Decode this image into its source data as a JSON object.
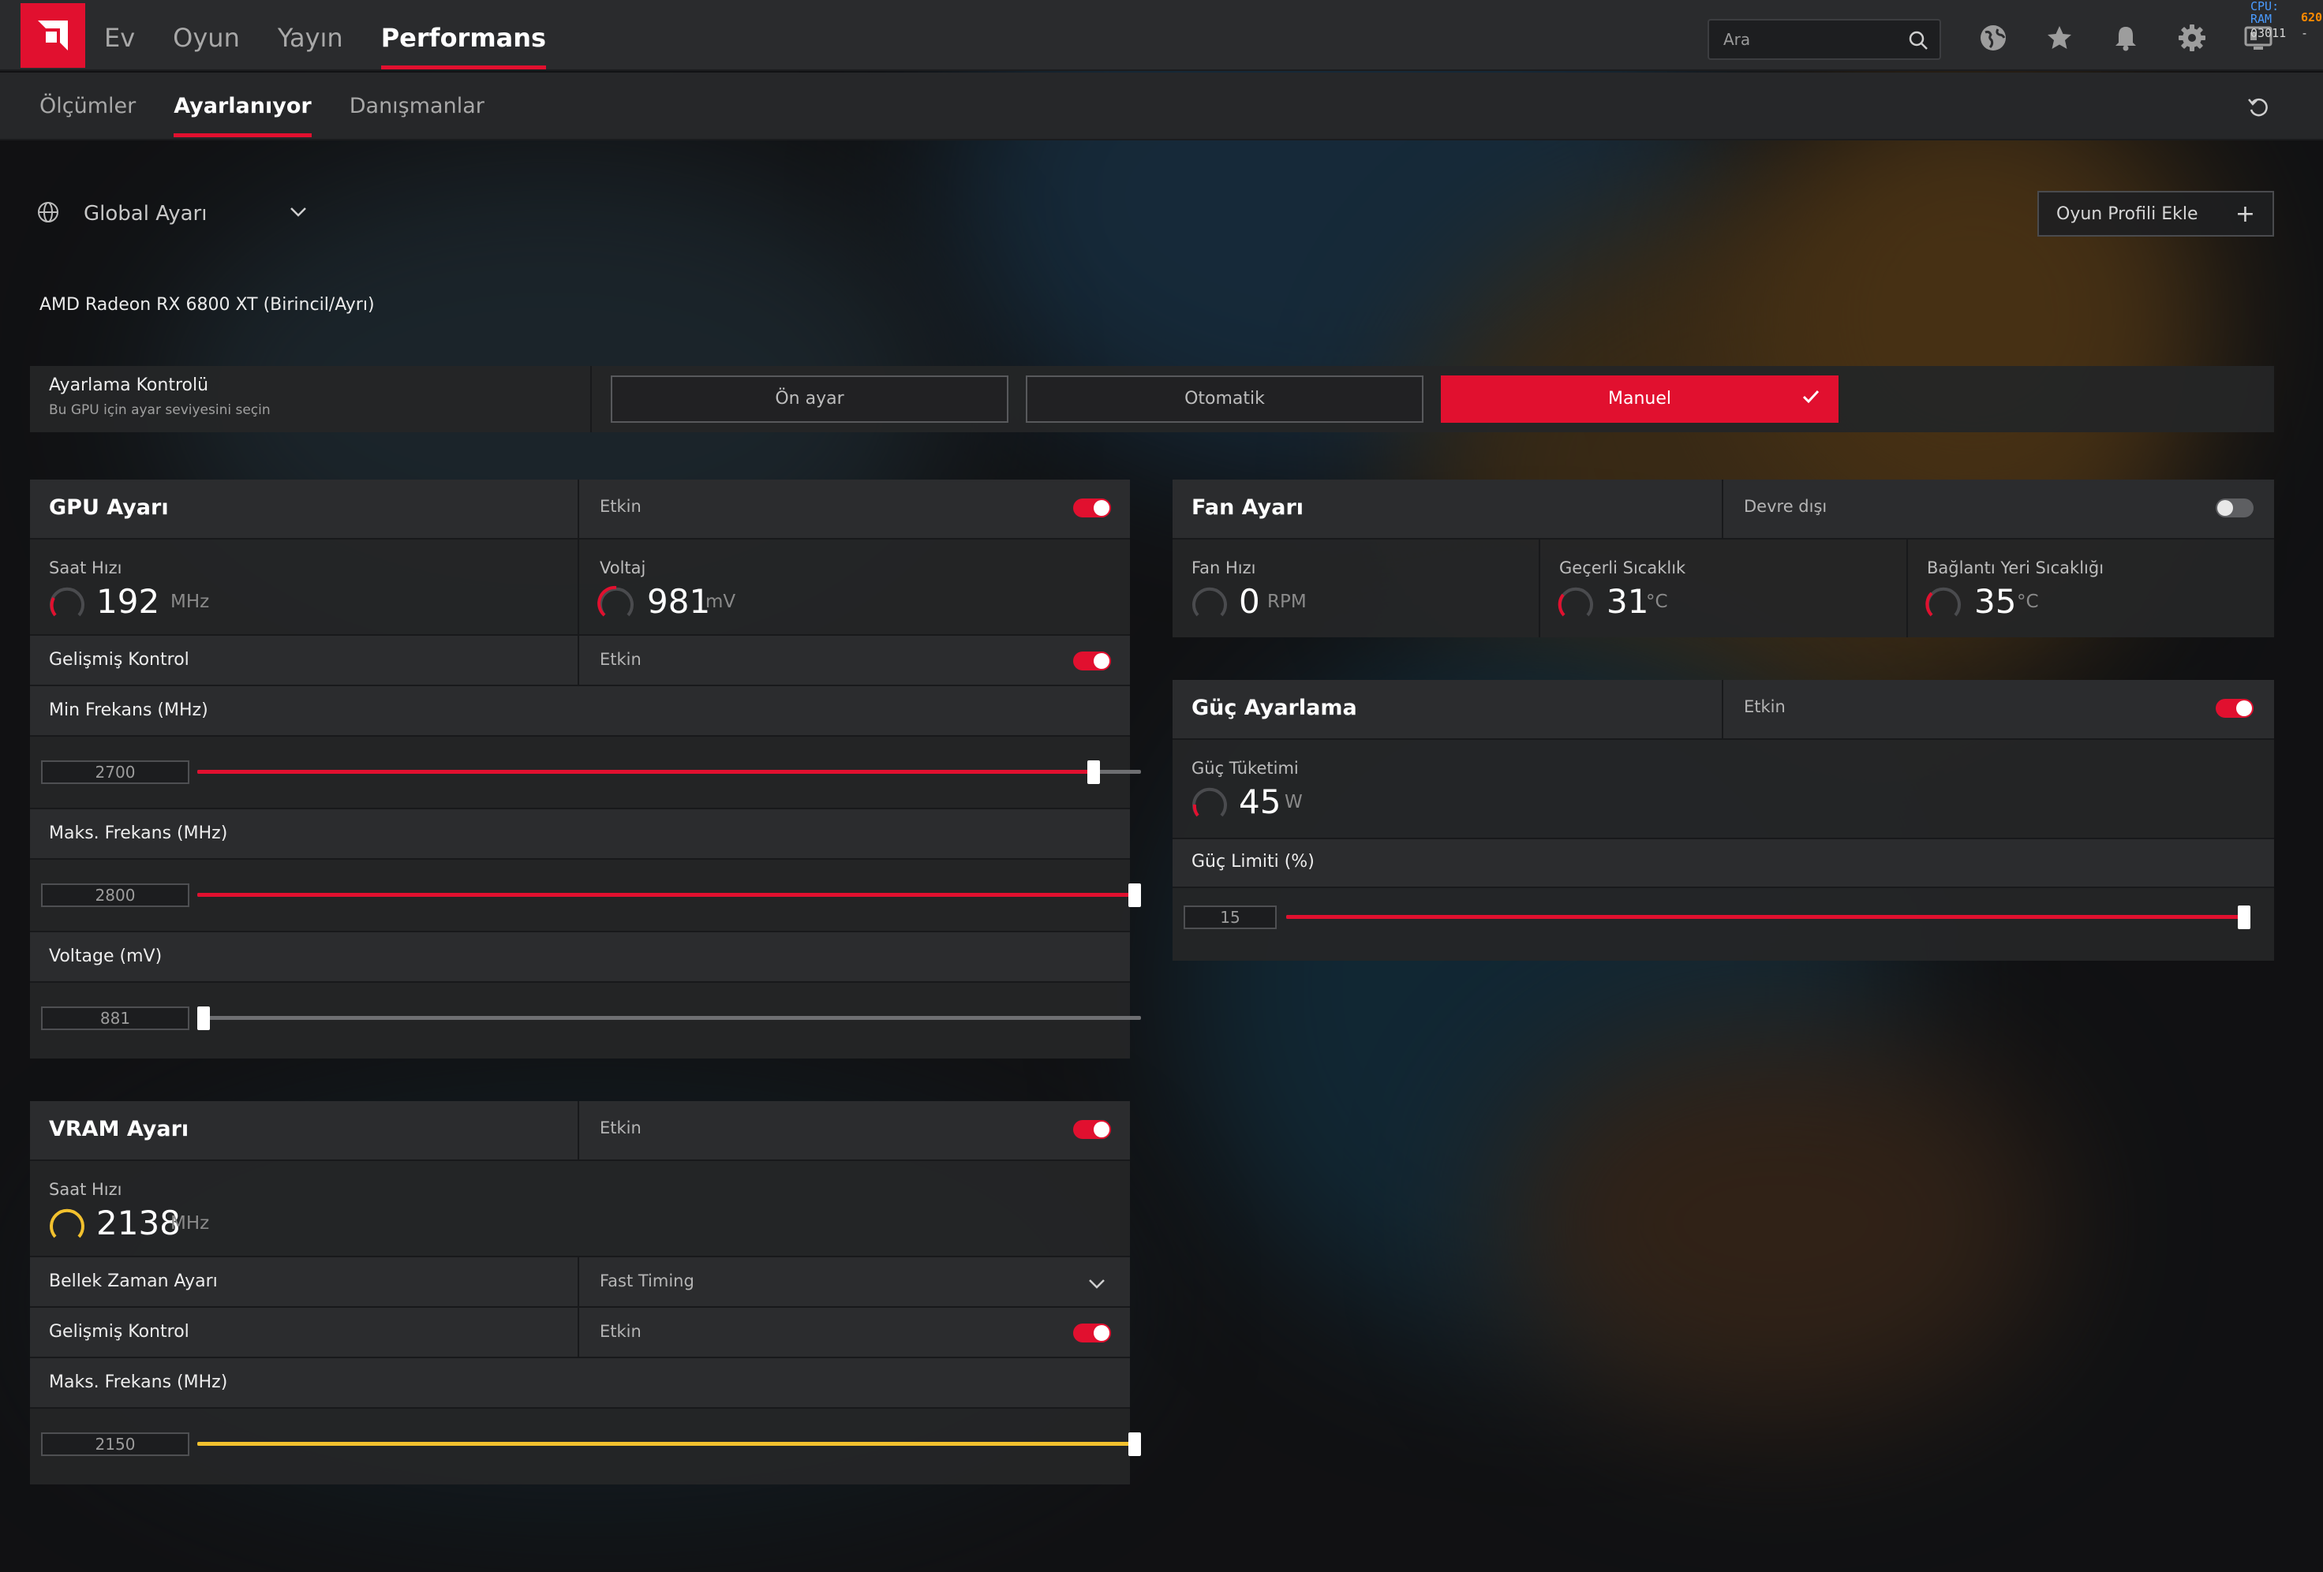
{
  "topnav": {
    "items": [
      "Ev",
      "Oyun",
      "Yayın",
      "Performans"
    ],
    "active_index": 3,
    "search_placeholder": "Ara",
    "icons": [
      "globe-icon",
      "star-icon",
      "bell-icon",
      "gear-icon",
      "monitor-icon"
    ],
    "overlay_stats": {
      "cpu_label": "CPU:",
      "ram_label": "RAM",
      "value_top": "620",
      "value_mid": "03011"
    }
  },
  "subnav": {
    "items": [
      "Ölçümler",
      "Ayarlanıyor",
      "Danışmanlar"
    ],
    "active_index": 1
  },
  "profile": {
    "selected": "Global Ayarı",
    "add_button": "Oyun Profili Ekle"
  },
  "gpu_name": "AMD Radeon RX 6800 XT (Birincil/Ayrı)",
  "tuning_control": {
    "title": "Ayarlama Kontrolü",
    "subtitle": "Bu GPU için ayar seviyesini seçin",
    "options": [
      "Ön ayar",
      "Otomatik",
      "Manuel"
    ],
    "selected": "Manuel"
  },
  "gpu_tuning": {
    "title": "GPU Ayarı",
    "status": "Etkin",
    "enabled": true,
    "clock": {
      "label": "Saat Hızı",
      "value": "192",
      "unit": "MHz"
    },
    "voltage": {
      "label": "Voltaj",
      "value": "981",
      "unit": "mV"
    },
    "advanced": {
      "label": "Gelişmiş Kontrol",
      "status": "Etkin",
      "enabled": true
    },
    "min_freq": {
      "label": "Min Frekans (MHz)",
      "value": "2700",
      "fraction": 0.95
    },
    "max_freq": {
      "label": "Maks. Frekans (MHz)",
      "value": "2800",
      "fraction": 1.0
    },
    "voltage_slider": {
      "label": "Voltage (mV)",
      "value": "881",
      "fraction": 0.0
    }
  },
  "vram_tuning": {
    "title": "VRAM Ayarı",
    "status": "Etkin",
    "enabled": true,
    "clock": {
      "label": "Saat Hızı",
      "value": "2138",
      "unit": "MHz"
    },
    "memory_timing": {
      "label": "Bellek Zaman Ayarı",
      "value": "Fast Timing"
    },
    "advanced": {
      "label": "Gelişmiş Kontrol",
      "status": "Etkin",
      "enabled": true
    },
    "max_freq": {
      "label": "Maks. Frekans (MHz)",
      "value": "2150",
      "fraction": 1.0
    }
  },
  "fan_tuning": {
    "title": "Fan Ayarı",
    "status": "Devre dışı",
    "enabled": false,
    "fan_speed": {
      "label": "Fan Hızı",
      "value": "0",
      "unit": "RPM"
    },
    "current_temp": {
      "label": "Geçerli Sıcaklık",
      "value": "31",
      "unit": "°C"
    },
    "junction_temp": {
      "label": "Bağlantı Yeri Sıcaklığı",
      "value": "35",
      "unit": "°C"
    }
  },
  "power_tuning": {
    "title": "Güç Ayarlama",
    "status": "Etkin",
    "enabled": true,
    "consumption": {
      "label": "Güç Tüketimi",
      "value": "45",
      "unit": "W"
    },
    "limit": {
      "label": "Güç Limiti (%)",
      "value": "15",
      "fraction": 1.0
    }
  },
  "colors": {
    "accent": "#e1102f",
    "vram_accent": "#f2c12e",
    "overlay_blue": "#4a9bff",
    "overlay_orange": "#ff8a00"
  }
}
